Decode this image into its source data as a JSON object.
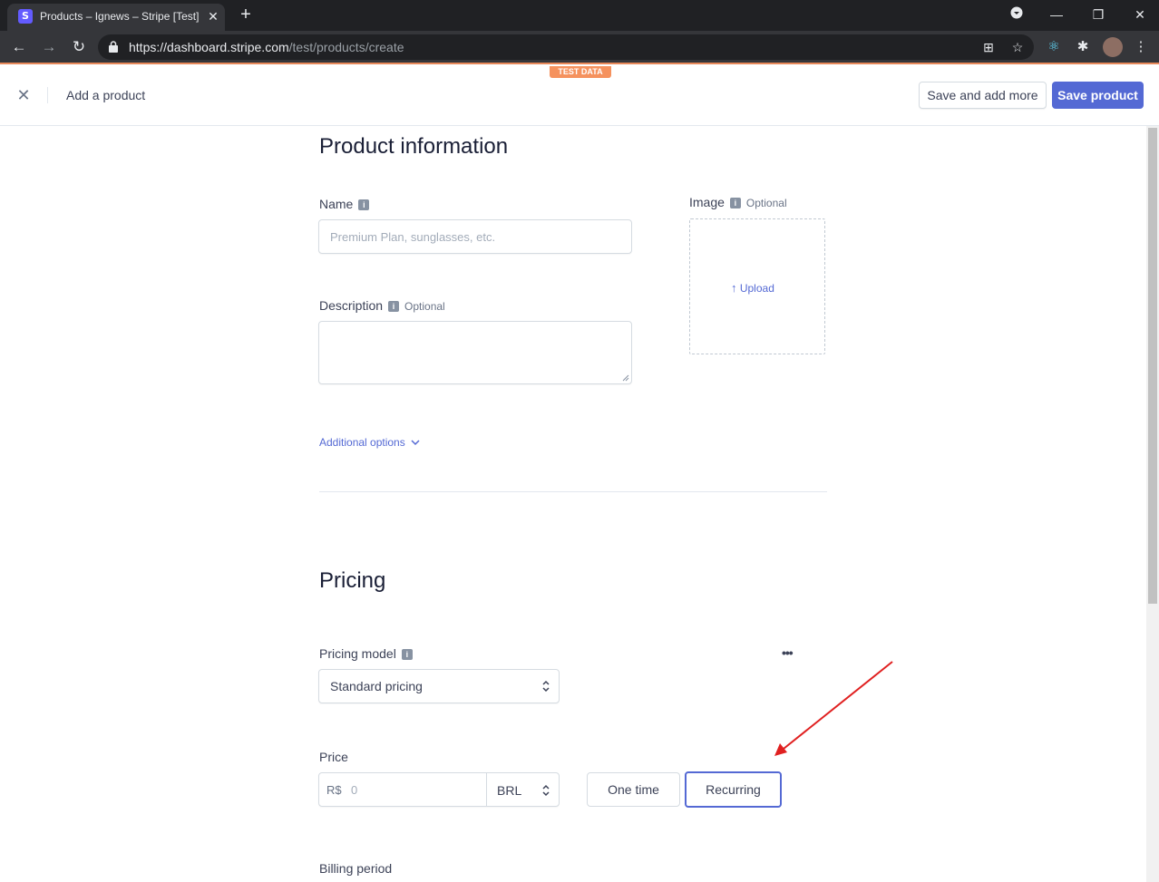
{
  "browser": {
    "tab_title": "Products – Ignews – Stripe [Test]",
    "favicon_letter": "S",
    "url_host": "https://dashboard.stripe.com",
    "url_path": "/test/products/create"
  },
  "badge": {
    "test_data": "TEST DATA"
  },
  "header": {
    "title": "Add a product",
    "save_and_add_more": "Save and add more",
    "save_product": "Save product"
  },
  "product_info": {
    "heading": "Product information",
    "name_label": "Name",
    "name_placeholder": "Premium Plan, sunglasses, etc.",
    "description_label": "Description",
    "description_optional": "Optional",
    "image_label": "Image",
    "image_optional": "Optional",
    "upload_label": "Upload",
    "additional_options": "Additional options"
  },
  "pricing": {
    "heading": "Pricing",
    "model_label": "Pricing model",
    "model_value": "Standard pricing",
    "price_label": "Price",
    "currency_symbol": "R$",
    "amount_placeholder": "0",
    "currency": "BRL",
    "one_time": "One time",
    "recurring": "Recurring",
    "billing_period_label": "Billing period"
  },
  "colors": {
    "accent": "#5469d4",
    "annotation_arrow": "#e02020",
    "test_badge": "#f5925e"
  }
}
